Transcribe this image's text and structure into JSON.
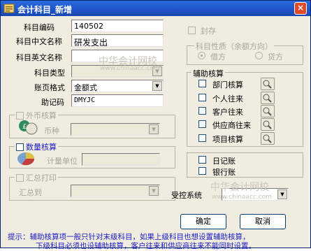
{
  "window": {
    "title": "会计科目_新增",
    "close": "×"
  },
  "fields": {
    "code": {
      "label": "科目编码",
      "value": "140502"
    },
    "cn_name": {
      "label": "科目中文名称",
      "value": "研发支出"
    },
    "en_name": {
      "label": "科目英文名称",
      "value": ""
    },
    "type": {
      "label": "科目类型",
      "value": ""
    },
    "page_format": {
      "label": "账页格式",
      "value": "金额式"
    },
    "mnemonic": {
      "label": "助记码",
      "value": "DMYJC"
    }
  },
  "seal": {
    "label": "封存"
  },
  "nature": {
    "title": "科目性质（余额方向）",
    "debit": "借方",
    "credit": "贷方"
  },
  "auxiliary": {
    "title": "辅助核算",
    "items": [
      {
        "label": "部门核算"
      },
      {
        "label": "个人往来"
      },
      {
        "label": "客户往来"
      },
      {
        "label": "供应商往来"
      },
      {
        "label": "项目核算"
      }
    ]
  },
  "foreign": {
    "title": "外币核算",
    "currency_label": "币种"
  },
  "quantity": {
    "title": "数量核算",
    "unit_label": "计量单位"
  },
  "summary": {
    "title": "汇总打印",
    "to_label": "汇总到"
  },
  "journals": {
    "daily": "日记账",
    "bank": "银行账"
  },
  "controlled": {
    "label": "受控系统",
    "value": ""
  },
  "buttons": {
    "ok": "确定",
    "cancel": "取消"
  },
  "tip": {
    "line1": "提示：辅助核算项一般只针对末级科目，如果上级科目也想设置辅助核算，",
    "line2": "下级科目必须也设辅助核算，客户往来和供应商往来不能同时设置。"
  },
  "watermark": {
    "text1": "中华会计网校",
    "text2": "www.chinaacc.com"
  },
  "colors": {
    "title_bar": "#1f53c8",
    "tip_text": "#1a1ac8",
    "dialog_bg": "#f0ede0"
  }
}
